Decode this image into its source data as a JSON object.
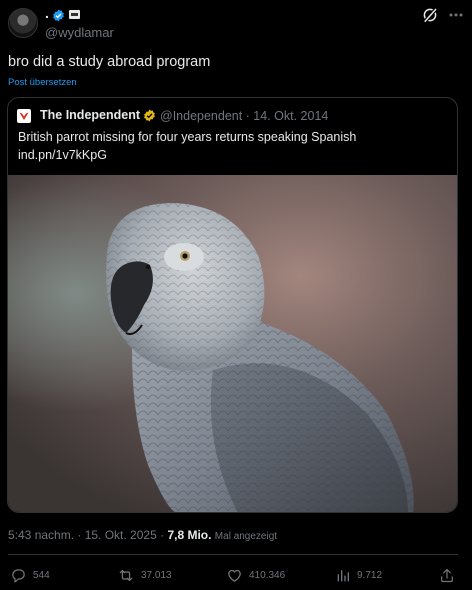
{
  "header": {
    "display_name": ".",
    "handle": "@wydlamar"
  },
  "tweet": {
    "text": "bro did a study abroad program",
    "translate_label": "Post übersetzen"
  },
  "quote": {
    "account_name": "The Independent",
    "handle_date": "@Independent · 14. Okt. 2014",
    "text": "British parrot missing for four years returns speaking Spanish",
    "link": "ind.pn/1v7kKpG"
  },
  "meta": {
    "time_date": "5:43 nachm. · 15. Okt. 2025 ·",
    "views_count": "7,8 Mio.",
    "views_label": "Mal angezeigt"
  },
  "actions": {
    "replies": "544",
    "reposts": "37.013",
    "likes": "410.346",
    "views": "9.712"
  },
  "colors": {
    "background": "#000000",
    "text": "#e7e9ea",
    "muted": "#71767b",
    "link": "#1d9bf0",
    "verified_blue": "#1d9bf0",
    "verified_gold": "#e2b719",
    "border": "#2f3336"
  }
}
